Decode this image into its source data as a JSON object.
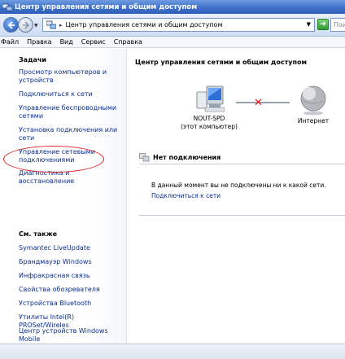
{
  "window": {
    "title": "Центр управления сетями и общим доступом"
  },
  "address_bar": {
    "path": "Центр управления сетями и общим доступом",
    "search_placeholder": "Пои"
  },
  "menu": [
    "Файл",
    "Правка",
    "Вид",
    "Сервис",
    "Справка"
  ],
  "sidebar": {
    "tasks_heading": "Задачи",
    "tasks": [
      "Просмотр компьютеров и устройств",
      "Подключиться к сети",
      "Управление беспроводными сетями",
      "Установка подключения или сети",
      "Управление сетевыми подключениями",
      "Диагностика и восстановление"
    ],
    "see_also_heading": "См. также",
    "see_also": [
      "Symantec LiveUpdate",
      "Брандмауэр Windows",
      "Инфракрасная связь",
      "Свойства обозревателя",
      "Устройства Bluetooth",
      "Утилиты Intel(R) PROSet/Wireles",
      "Центр устройств Windows Mobile"
    ]
  },
  "main": {
    "title": "Центр управления сетями и общим доступом",
    "computer_name": "NOUT-SPD",
    "computer_caption": "(этот компьютер)",
    "internet_label": "Интернет",
    "section_heading": "Нет подключения",
    "status_message": "В данный момент вы не подключены ни к какой сети.",
    "connect_link": "Подключиться к сети"
  },
  "colors": {
    "link": "#0a2e8c",
    "highlight": "#e0262a",
    "disconnected_x": "#e01b1b"
  }
}
